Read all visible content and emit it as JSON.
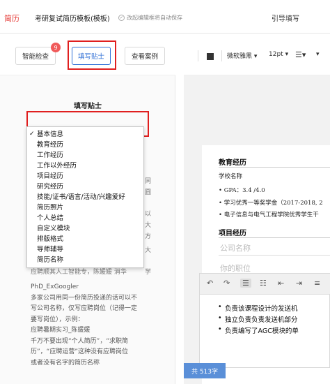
{
  "header": {
    "brand": "简历",
    "title": "考研复试简历模板(模板)",
    "save_status": "改起编辑框将自动保存",
    "guide_link": "引导填写"
  },
  "left_toolbar": {
    "smart_check": "智能检查",
    "badge_count": "9",
    "fill_tips": "填写贴士",
    "view_cases": "查看案例"
  },
  "tips": {
    "title": "填写贴士",
    "partial_line": "应聘顺其人工智能专，陈媛媛 消华",
    "body_lines": [
      "PhD_ExGoogler",
      "多家公司用同一份简历投递的话可以不",
      "写公司名称，仅写应聘岗位（记得一定",
      "要写岗位），示例：",
      "应聘暑期实习_陈媛媛",
      "千万不要出现“个人简历”，“求职简",
      "历”，“应聘运营”这种没有应聘岗位",
      "或者没有名字的简历名称"
    ],
    "side_glyphs": [
      "同",
      "圆",
      "以",
      "大",
      "方",
      "大",
      "学"
    ]
  },
  "dropdown": {
    "selected": "基本信息",
    "items": [
      "基本信息",
      "教育经历",
      "工作经历",
      "工作以外经历",
      "项目经历",
      "研究经历",
      "技能/证书/语言/活动/兴趣爱好",
      "简历照片",
      "个人总结",
      "自定义模块",
      "排版格式",
      "导师辅导",
      "简历名称"
    ]
  },
  "right_toolbar": {
    "font": "微软雅黑",
    "size": "12pt"
  },
  "resume": {
    "education_title": "教育经历",
    "school": "学校名称",
    "gpa": "GPA：3.4 /4.0",
    "scholarship": "学习优秀一等奖学金（2017-2018, 2",
    "honor": "电子信息与电气工程学院优秀学生干",
    "project_title": "项目经历",
    "company_placeholder": "公司名称",
    "position_placeholder": "你的职位",
    "editor_items": [
      "负责该课程设计的发送机",
      "独立负责负责发送机部分",
      "负责编写了AGC模块的单"
    ],
    "word_count": "共 513字"
  }
}
